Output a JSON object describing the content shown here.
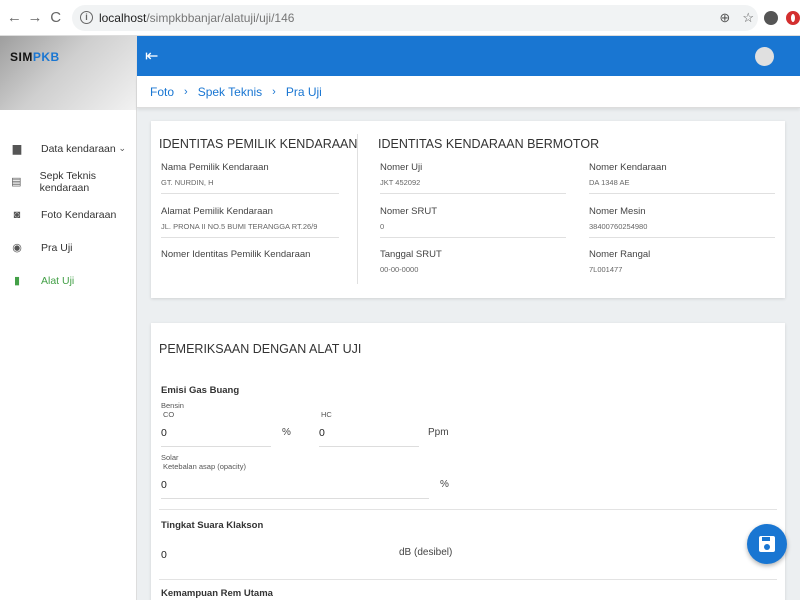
{
  "browser": {
    "url_host": "localhost",
    "url_path": "/simpkbbanjar/alatuji/uji/146",
    "back_glyph": "←",
    "forward_glyph": "→",
    "reload_glyph": "C",
    "zoom_glyph": "⊕",
    "star_glyph": "☆"
  },
  "logo": {
    "sim": "SIM",
    "pkb": "PKB"
  },
  "sidebar": {
    "items": [
      {
        "label": "Data kendaraan",
        "icon": "car-icon",
        "glyph": "▆",
        "chevron": "⌄"
      },
      {
        "label": "Sepk Teknis kendaraan",
        "icon": "clipboard-icon",
        "glyph": "▤"
      },
      {
        "label": "Foto Kendaraan",
        "icon": "camera-icon",
        "glyph": "◙"
      },
      {
        "label": "Pra Uji",
        "icon": "target-icon",
        "glyph": "◉"
      },
      {
        "label": "Alat Uji",
        "icon": "bar-chart-icon",
        "glyph": "▮"
      }
    ],
    "active_index": 4
  },
  "appbar": {
    "back_glyph": "⇤"
  },
  "tabs": {
    "items": [
      "Foto",
      "Spek Teknis",
      "Pra Uji"
    ],
    "separator": "›"
  },
  "owner": {
    "title": "IDENTITAS PEMILIK KENDARAAN",
    "name_label": "Nama Pemilik Kendaraan",
    "name_value": "GT. NURDIN, H",
    "address_label": "Alamat Pemilik Kendaraan",
    "address_value": "JL. PRONA II NO.5 BUMI TERANGGA RT.26/9",
    "id_label": "Nomer Identitas Pemilik Kendaraan"
  },
  "vehicle": {
    "title": "IDENTITAS KENDARAAN BERMOTOR",
    "uji_label": "Nomer Uji",
    "uji_value": "JKT 452092",
    "srut_label": "Nomer SRUT",
    "srut_value": "0",
    "tgl_label": "Tanggal SRUT",
    "tgl_value": "00-00-0000",
    "kend_label": "Nomer Kendaraan",
    "kend_value": "DA 1348 AE",
    "mesin_label": "Nomer Mesin",
    "mesin_value": "38400760254980",
    "rangka_label": "Nomer Rangal",
    "rangka_value": "7L001477"
  },
  "exam": {
    "title": "PEMERIKSAAN DENGAN ALAT UJI",
    "emisi_title": "Emisi Gas Buang",
    "bensin": "Bensin",
    "co_label": "CO",
    "co_value": "0",
    "co_unit": "%",
    "hc_label": "HC",
    "hc_value": "0",
    "hc_unit": "Ppm",
    "solar": "Solar",
    "opacity_label": "Ketebalan asap (opacity)",
    "opacity_value": "0",
    "opacity_unit": "%",
    "klakson_title": "Tingkat Suara Klakson",
    "klakson_value": "0",
    "klakson_unit": "dB (desibel)",
    "rem_title": "Kemampuan Rem Utama"
  },
  "fab": {
    "icon": "save-icon"
  }
}
